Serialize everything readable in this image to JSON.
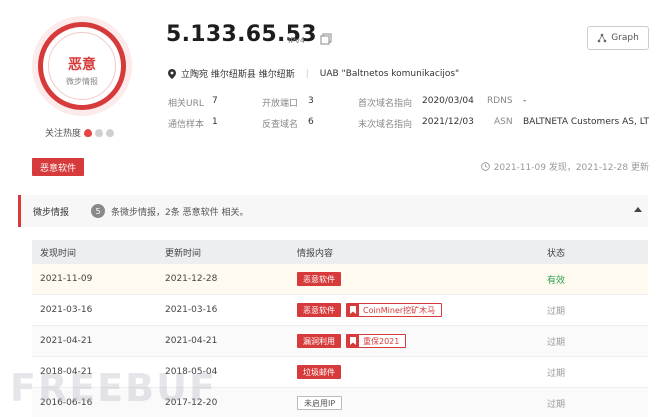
{
  "verdict": {
    "label": "恶意",
    "sub": "微步情报"
  },
  "heat": {
    "label": "关注热度",
    "level": 1,
    "max": 3
  },
  "ip": {
    "address": "5.133.65.53",
    "version": "IPv4"
  },
  "graph_label": "Graph",
  "location": {
    "place": "立陶宛 维尔纽斯县 维尔纽斯",
    "org": "UAB \"Baltnetos komunikacijos\""
  },
  "stats": {
    "url_label": "相关URL",
    "url_val": "7",
    "ports_label": "开放端口",
    "ports_val": "3",
    "first_label": "首次域名指向",
    "first_val": "2020/03/04",
    "rdns_label": "RDNS",
    "rdns_val": "-",
    "sample_label": "通信样本",
    "sample_val": "1",
    "rev_label": "反查域名",
    "rev_val": "6",
    "last_label": "末次域名指向",
    "last_val": "2021/12/03",
    "asn_label": "ASN",
    "asn_val": "BALTNETA Customers AS, LT"
  },
  "tag": "恶意软件",
  "time": "2021-11-09 发现，2021-12-28 更新",
  "section": {
    "title": "微步情报",
    "count": "5",
    "desc": "条微步情报，2条 恶意软件 相关。"
  },
  "table": {
    "headers": [
      "发现时间",
      "更新时间",
      "情报内容",
      "状态"
    ],
    "rows": [
      {
        "found": "2021-11-09",
        "updated": "2021-12-28",
        "tags": [
          "恶意软件"
        ],
        "extra": "",
        "status": "有效"
      },
      {
        "found": "2021-03-16",
        "updated": "2021-03-16",
        "tags": [
          "恶意软件"
        ],
        "extra": "CoinMiner挖矿木马",
        "status": "过期"
      },
      {
        "found": "2021-04-21",
        "updated": "2021-04-21",
        "tags": [
          "漏洞利用"
        ],
        "extra": "重保2021",
        "status": "过期"
      },
      {
        "found": "2018-04-21",
        "updated": "2018-05-04",
        "tags": [
          "垃圾邮件"
        ],
        "extra": "",
        "status": "过期"
      },
      {
        "found": "2016-06-16",
        "updated": "2017-12-20",
        "tags": [
          "未启用IP"
        ],
        "extra": "",
        "status": "过期"
      }
    ]
  },
  "watermark": "FREEBUF"
}
